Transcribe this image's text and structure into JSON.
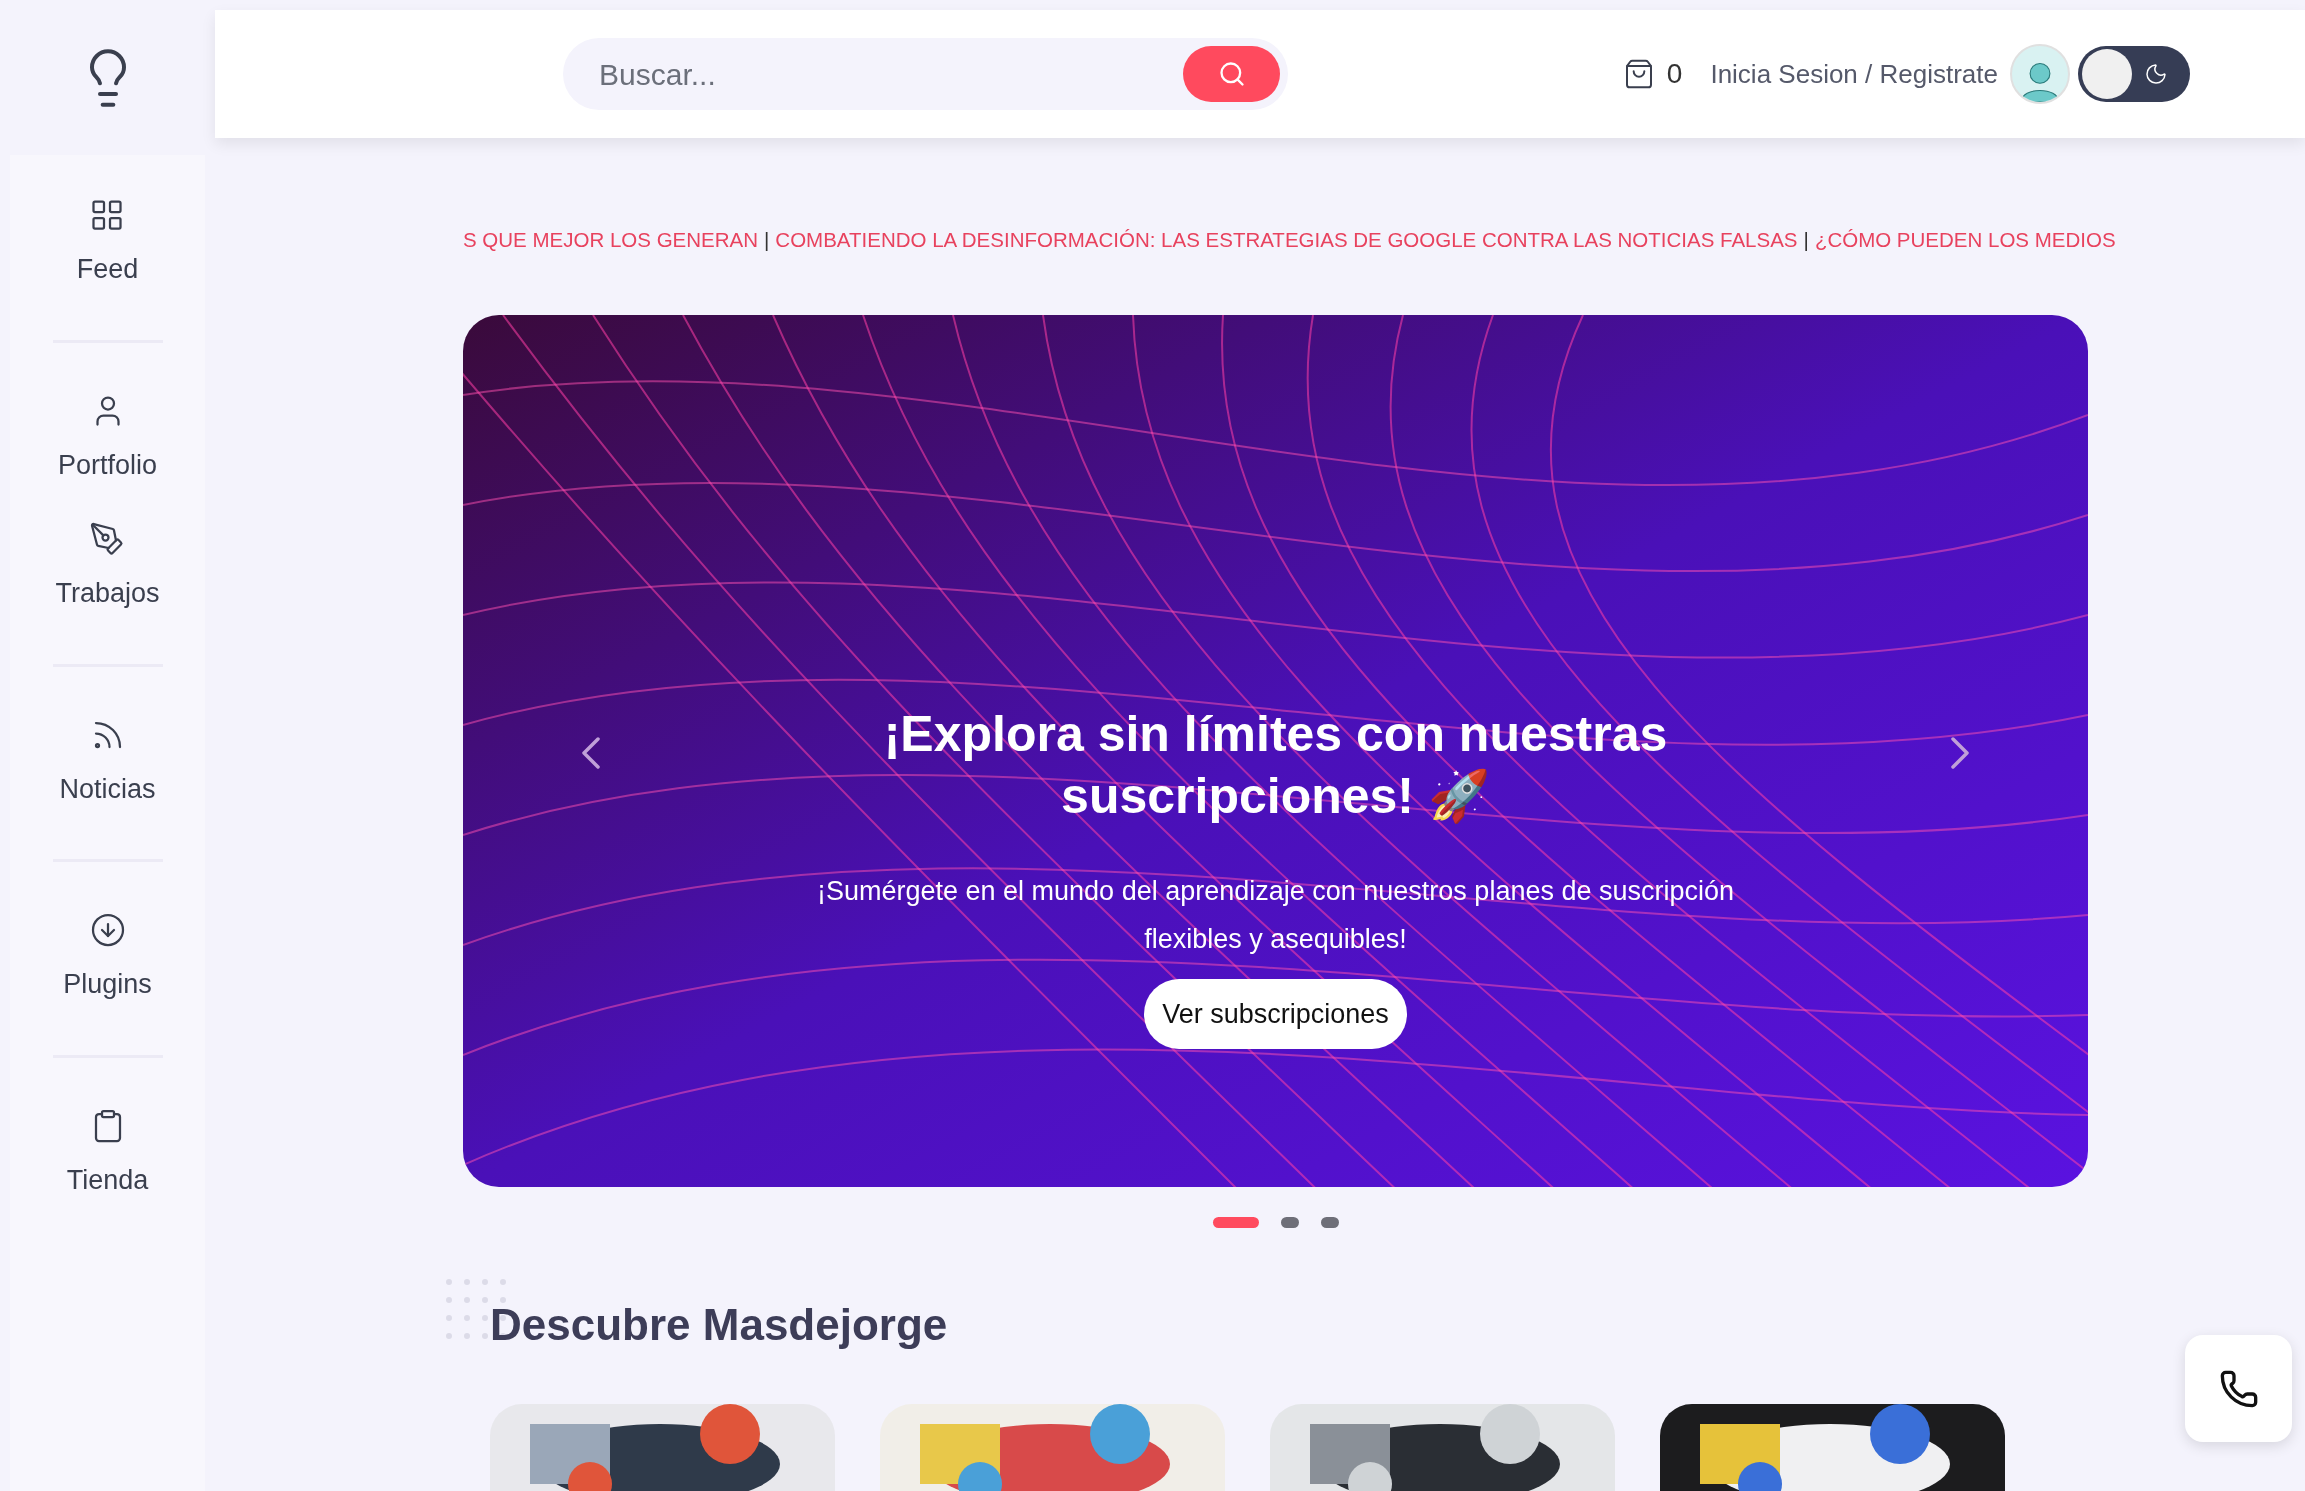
{
  "sidebar": {
    "groups": [
      [
        {
          "label": "Feed"
        }
      ],
      [
        {
          "label": "Portfolio"
        },
        {
          "label": "Trabajos"
        }
      ],
      [
        {
          "label": "Noticias"
        }
      ],
      [
        {
          "label": "Plugins"
        }
      ],
      [
        {
          "label": "Tienda"
        }
      ]
    ]
  },
  "header": {
    "search": {
      "placeholder": "Buscar..."
    },
    "cart_count": "0",
    "login": "Inicia Sesion / Registrate",
    "dark_mode": {
      "on": false
    }
  },
  "ticker": [
    {
      "text": "S QUE MEJOR LOS GENERAN",
      "separator": "|"
    },
    {
      "text": "COMBATIENDO LA DESINFORMACIÓN: LAS ESTRATEGIAS DE GOOGLE CONTRA LAS NOTICIAS FALSAS",
      "separator": "|"
    },
    {
      "text": "¿CÓMO PUEDEN LOS MEDIOS"
    }
  ],
  "banner": {
    "title": "¡Explora sin límites con nuestras suscripciones! 🚀",
    "text": "¡Sumérgete en el mundo del aprendizaje con nuestros planes de suscripción flexibles y asequibles!",
    "button": "Ver subscripciones",
    "dots": [
      {
        "selected": true
      },
      {
        "selected": false
      },
      {
        "selected": false
      }
    ]
  },
  "section": {
    "title": "Descubre Masdejorge"
  }
}
